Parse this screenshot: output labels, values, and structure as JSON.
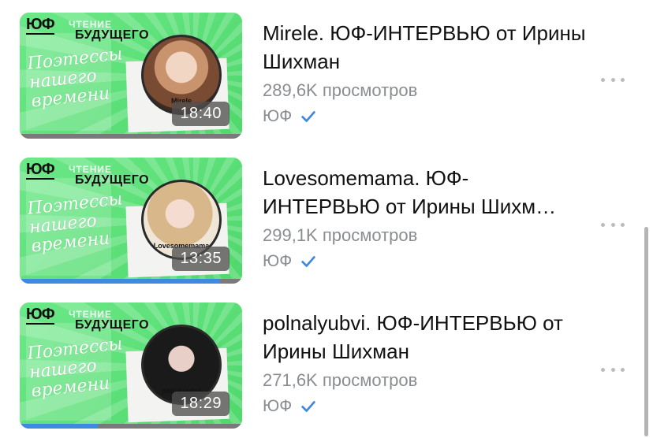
{
  "videos": [
    {
      "title": "Mirele. ЮФ-ИНТЕРВЬЮ от Ирины Шихман",
      "views": "289,6K просмотров",
      "channel": "ЮФ",
      "duration": "18:40",
      "progress": 0,
      "thumb": {
        "logo": "ЮФ",
        "top_text": "ЧТЕНИЕ",
        "series_text": "БУДУЩЕГО",
        "poet_text": "Поэтессы нашего времени",
        "guest_name": "Mirele"
      }
    },
    {
      "title": "Lovesomemama. ЮФ-ИНТЕРВЬЮ от Ирины Шихм…",
      "views": "299,1K просмотров",
      "channel": "ЮФ",
      "duration": "13:35",
      "progress": 0.9,
      "thumb": {
        "logo": "ЮФ",
        "top_text": "ЧТЕНИЕ",
        "series_text": "БУДУЩЕГО",
        "poet_text": "Поэтессы нашего времени",
        "guest_name": "Lovesomemama"
      }
    },
    {
      "title": "polnalyubvi. ЮФ-ИНТЕРВЬЮ от Ирины Шихман",
      "views": "271,6K просмотров",
      "channel": "ЮФ",
      "duration": "18:29",
      "progress": 0.35,
      "thumb": {
        "logo": "ЮФ",
        "top_text": "ЧТЕНИЕ",
        "series_text": "БУДУЩЕГО",
        "poet_text": "Поэтессы нашего времени",
        "guest_name": "polnalyubvi"
      }
    }
  ],
  "colors": {
    "accent": "#3f8ae0",
    "thumb_green": "#5fe07a",
    "secondary_text": "#8a8d91"
  },
  "icons": {
    "verified": "verified-check-icon",
    "more": "more-dots-icon"
  }
}
